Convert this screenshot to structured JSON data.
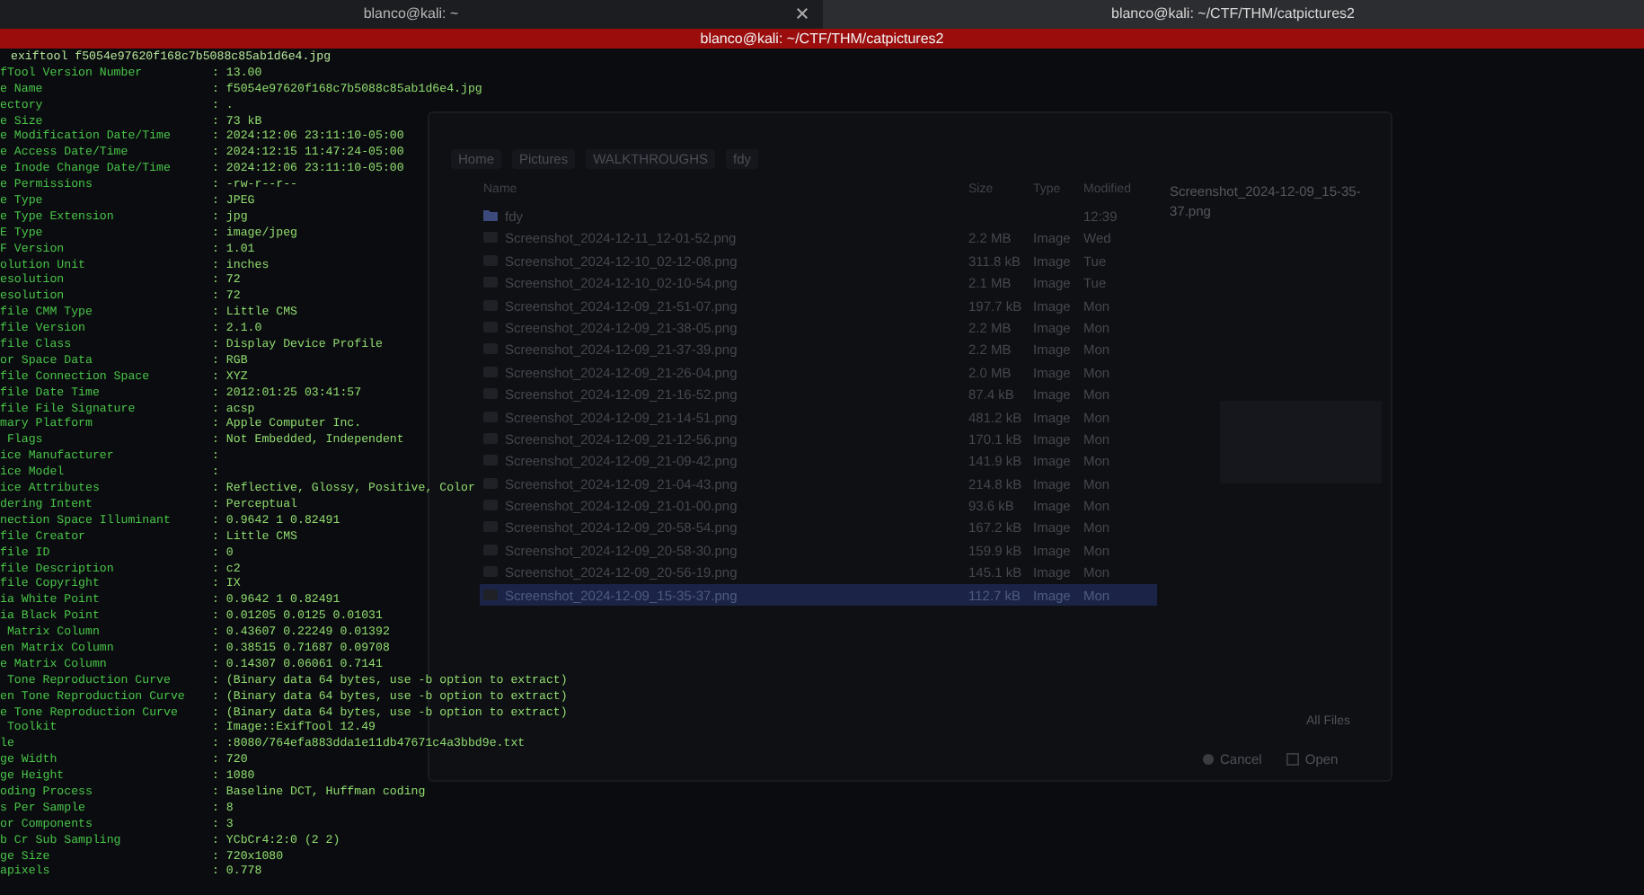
{
  "tabs": [
    {
      "label": "blanco@kali: ~",
      "selected": false,
      "closable": true
    },
    {
      "label": "blanco@kali: ~/CTF/THM/catpictures2",
      "selected": true,
      "closable": false
    }
  ],
  "window": {
    "title": "blanco@kali: ~/CTF/THM/catpictures2"
  },
  "file_dialog": {
    "breadcrumbs": [
      "Home",
      "Pictures",
      "WALKTHROUGHS",
      "fdy"
    ],
    "columns": [
      "Name",
      "Size",
      "Type",
      "Modified"
    ],
    "files": [
      {
        "kind": "folder",
        "name": "fdy",
        "modified": "12:39",
        "selected": false
      },
      {
        "kind": "image",
        "name": "Screenshot_2024-12-11_12-01-52.png",
        "size": "2.2 MB",
        "type": "Image",
        "modified": "Wed",
        "selected": false
      },
      {
        "kind": "image",
        "name": "Screenshot_2024-12-10_02-12-08.png",
        "size": "311.8 kB",
        "type": "Image",
        "modified": "Tue",
        "selected": false
      },
      {
        "kind": "image",
        "name": "Screenshot_2024-12-10_02-10-54.png",
        "size": "2.1 MB",
        "type": "Image",
        "modified": "Tue",
        "selected": false
      },
      {
        "kind": "image",
        "name": "Screenshot_2024-12-09_21-51-07.png",
        "size": "197.7 kB",
        "type": "Image",
        "modified": "Mon",
        "selected": false
      },
      {
        "kind": "image",
        "name": "Screenshot_2024-12-09_21-38-05.png",
        "size": "2.2 MB",
        "type": "Image",
        "modified": "Mon",
        "selected": false
      },
      {
        "kind": "image",
        "name": "Screenshot_2024-12-09_21-37-39.png",
        "size": "2.2 MB",
        "type": "Image",
        "modified": "Mon",
        "selected": false
      },
      {
        "kind": "image",
        "name": "Screenshot_2024-12-09_21-26-04.png",
        "size": "2.0 MB",
        "type": "Image",
        "modified": "Mon",
        "selected": false
      },
      {
        "kind": "image",
        "name": "Screenshot_2024-12-09_21-16-52.png",
        "size": "87.4 kB",
        "type": "Image",
        "modified": "Mon",
        "selected": false
      },
      {
        "kind": "image",
        "name": "Screenshot_2024-12-09_21-14-51.png",
        "size": "481.2 kB",
        "type": "Image",
        "modified": "Mon",
        "selected": false
      },
      {
        "kind": "image",
        "name": "Screenshot_2024-12-09_21-12-56.png",
        "size": "170.1 kB",
        "type": "Image",
        "modified": "Mon",
        "selected": false
      },
      {
        "kind": "image",
        "name": "Screenshot_2024-12-09_21-09-42.png",
        "size": "141.9 kB",
        "type": "Image",
        "modified": "Mon",
        "selected": false
      },
      {
        "kind": "image",
        "name": "Screenshot_2024-12-09_21-04-43.png",
        "size": "214.8 kB",
        "type": "Image",
        "modified": "Mon",
        "selected": false
      },
      {
        "kind": "image",
        "name": "Screenshot_2024-12-09_21-01-00.png",
        "size": "93.6 kB",
        "type": "Image",
        "modified": "Mon",
        "selected": false
      },
      {
        "kind": "image",
        "name": "Screenshot_2024-12-09_20-58-54.png",
        "size": "167.2 kB",
        "type": "Image",
        "modified": "Mon",
        "selected": false
      },
      {
        "kind": "image",
        "name": "Screenshot_2024-12-09_20-58-30.png",
        "size": "159.9 kB",
        "type": "Image",
        "modified": "Mon",
        "selected": false
      },
      {
        "kind": "image",
        "name": "Screenshot_2024-12-09_20-56-19.png",
        "size": "145.1 kB",
        "type": "Image",
        "modified": "Mon",
        "selected": false
      },
      {
        "kind": "image",
        "name": "Screenshot_2024-12-09_15-35-37.png",
        "size": "112.7 kB",
        "type": "Image",
        "modified": "Mon",
        "selected": true
      }
    ],
    "preview_title": "Screenshot_2024-12-09_15-35-37.png",
    "filter": "All Files",
    "buttons": [
      {
        "kind": "cancel",
        "label": "Cancel"
      },
      {
        "kind": "open",
        "label": "Open"
      }
    ]
  },
  "terminal": {
    "command": "exiftool f5054e97620f168c7b5088c85ab1d6e4.jpg",
    "lines": [
      {
        "label": "fTool Version Number",
        "value": ": 13.00"
      },
      {
        "label": "e Name",
        "value": ": f5054e97620f168c7b5088c85ab1d6e4.jpg"
      },
      {
        "label": "ectory",
        "value": ": ."
      },
      {
        "label": "e Size",
        "value": ": 73 kB"
      },
      {
        "label": "e Modification Date/Time",
        "value": ": 2024:12:06 23:11:10-05:00"
      },
      {
        "label": "e Access Date/Time",
        "value": ": 2024:12:15 11:47:24-05:00"
      },
      {
        "label": "e Inode Change Date/Time",
        "value": ": 2024:12:06 23:11:10-05:00"
      },
      {
        "label": "e Permissions",
        "value": ": -rw-r--r--"
      },
      {
        "label": "e Type",
        "value": ": JPEG"
      },
      {
        "label": "e Type Extension",
        "value": ": jpg"
      },
      {
        "label": "E Type",
        "value": ": image/jpeg"
      },
      {
        "label": "F Version",
        "value": ": 1.01"
      },
      {
        "label": "olution Unit",
        "value": ": inches"
      },
      {
        "label": "esolution",
        "value": ": 72"
      },
      {
        "label": "esolution",
        "value": ": 72"
      },
      {
        "label": "file CMM Type",
        "value": ": Little CMS"
      },
      {
        "label": "file Version",
        "value": ": 2.1.0"
      },
      {
        "label": "file Class",
        "value": ": Display Device Profile"
      },
      {
        "label": "or Space Data",
        "value": ": RGB"
      },
      {
        "label": "file Connection Space",
        "value": ": XYZ"
      },
      {
        "label": "file Date Time",
        "value": ": 2012:01:25 03:41:57"
      },
      {
        "label": "file File Signature",
        "value": ": acsp"
      },
      {
        "label": "mary Platform",
        "value": ": Apple Computer Inc."
      },
      {
        "label": " Flags",
        "value": ": Not Embedded, Independent"
      },
      {
        "label": "ice Manufacturer",
        "value": ":"
      },
      {
        "label": "ice Model",
        "value": ":"
      },
      {
        "label": "ice Attributes",
        "value": ": Reflective, Glossy, Positive, Color"
      },
      {
        "label": "dering Intent",
        "value": ": Perceptual"
      },
      {
        "label": "nection Space Illuminant",
        "value": ": 0.9642 1 0.82491"
      },
      {
        "label": "file Creator",
        "value": ": Little CMS"
      },
      {
        "label": "file ID",
        "value": ": 0"
      },
      {
        "label": "file Description",
        "value": ": c2"
      },
      {
        "label": "file Copyright",
        "value": ": IX"
      },
      {
        "label": "ia White Point",
        "value": ": 0.9642 1 0.82491"
      },
      {
        "label": "ia Black Point",
        "value": ": 0.01205 0.0125 0.01031"
      },
      {
        "label": " Matrix Column",
        "value": ": 0.43607 0.22249 0.01392"
      },
      {
        "label": "en Matrix Column",
        "value": ": 0.38515 0.71687 0.09708"
      },
      {
        "label": "e Matrix Column",
        "value": ": 0.14307 0.06061 0.7141"
      },
      {
        "label": " Tone Reproduction Curve",
        "value": ": (Binary data 64 bytes, use -b option to extract)"
      },
      {
        "label": "en Tone Reproduction Curve",
        "value": ": (Binary data 64 bytes, use -b option to extract)"
      },
      {
        "label": "e Tone Reproduction Curve",
        "value": ": (Binary data 64 bytes, use -b option to extract)"
      },
      {
        "label": " Toolkit",
        "value": ": Image::ExifTool 12.49"
      },
      {
        "label": "le",
        "value": ": :8080/764efa883dda1e11db47671c4a3bbd9e.txt"
      },
      {
        "label": "ge Width",
        "value": ": 720"
      },
      {
        "label": "ge Height",
        "value": ": 1080"
      },
      {
        "label": "oding Process",
        "value": ": Baseline DCT, Huffman coding"
      },
      {
        "label": "s Per Sample",
        "value": ": 8"
      },
      {
        "label": "or Components",
        "value": ": 3"
      },
      {
        "label": "b Cr Sub Sampling",
        "value": ": YCbCr4:2:0 (2 2)"
      },
      {
        "label": "ge Size",
        "value": ": 720x1080"
      },
      {
        "label": "apixels",
        "value": ": 0.778"
      }
    ]
  }
}
